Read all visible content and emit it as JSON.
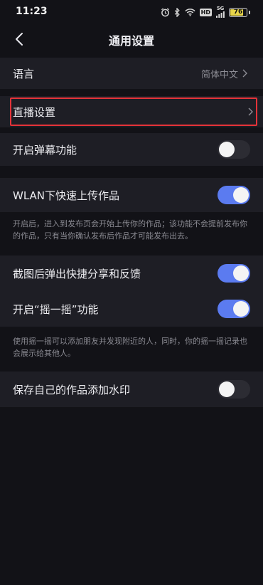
{
  "status_bar": {
    "time": "11:23",
    "network_label": "5G",
    "hd_label": "HD",
    "battery": "76",
    "battery_level": 0.76
  },
  "header": {
    "title": "通用设置"
  },
  "settings": {
    "language": {
      "label": "语言",
      "value": "简体中文"
    },
    "live": {
      "label": "直播设置"
    },
    "danmaku": {
      "label": "开启弹幕功能",
      "enabled": false
    },
    "wlan_upload": {
      "label": "WLAN下快速上传作品",
      "enabled": true,
      "description": "开启后，进入到发布页会开始上传你的作品；该功能不会提前发布你的作品，只有当你确认发布后作品才可能发布出去。"
    },
    "screenshot_share": {
      "label": "截图后弹出快捷分享和反馈",
      "enabled": true
    },
    "shake": {
      "label": "开启“摇一摇”功能",
      "enabled": true,
      "description": "使用摇一摇可以添加朋友并发现附近的人，同时，你的摇一摇记录也会展示给其他人。"
    },
    "watermark": {
      "label": "保存自己的作品添加水印",
      "enabled": false
    }
  },
  "colors": {
    "background": "#121217",
    "row": "#1e1e25",
    "toggle_on": "#5b7bf0",
    "toggle_off": "#2c2c33",
    "highlight": "#e53339"
  }
}
